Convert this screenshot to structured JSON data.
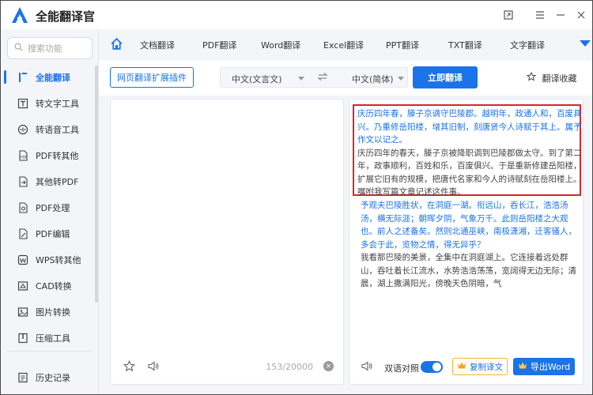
{
  "app": {
    "title": "全能翻译官"
  },
  "window": {
    "restore_icon": "restore-icon",
    "menu_icon": "menu-icon",
    "minimize_icon": "minimize-icon",
    "close_icon": "close-icon"
  },
  "sidebar": {
    "search_placeholder": "搜索功能",
    "items": [
      {
        "label": "全能翻译",
        "icon": "translate-icon",
        "active": true
      },
      {
        "label": "转文字工具",
        "icon": "text-convert-icon"
      },
      {
        "label": "转语音工具",
        "icon": "speech-icon"
      },
      {
        "label": "PDF转其他",
        "icon": "pdf-export-icon"
      },
      {
        "label": "其他转PDF",
        "icon": "pdf-import-icon"
      },
      {
        "label": "PDF处理",
        "icon": "pdf-process-icon"
      },
      {
        "label": "PDF编辑",
        "icon": "pdf-edit-icon"
      },
      {
        "label": "WPS转其他",
        "icon": "wps-icon"
      },
      {
        "label": "CAD转换",
        "icon": "cad-icon"
      },
      {
        "label": "图片转换",
        "icon": "image-icon"
      },
      {
        "label": "压缩工具",
        "icon": "compress-icon"
      }
    ],
    "history": "历史记录"
  },
  "tabs": {
    "items": [
      "文档翻译",
      "PDF翻译",
      "Word翻译",
      "Excel翻译",
      "PPT翻译",
      "TXT翻译",
      "文字翻译"
    ],
    "active": "文字翻译"
  },
  "toolbar": {
    "extension_button": "网页翻译扩展插件",
    "source_lang": "中文(文言文)",
    "target_lang": "中文(简体)",
    "translate_button": "立即翻译",
    "favorites": "翻译收藏"
  },
  "input_panel": {
    "count": "153/20000"
  },
  "output_panel": {
    "highlighted_source": "庆历四年春，滕子京谪守巴陵郡。越明年，政通人和，百废具兴。乃重修岳阳楼，增其旧制，刻唐贤今人诗赋于其上。属予作文以记之。",
    "highlighted_target": "庆历四年的春天，滕子京被降职调到巴陵郡做太守。到了第二年，政事顺利，百姓和乐，百废俱兴。于是重新修建岳阳楼，扩展它旧有的规模，把唐代名家和今人的诗赋刻在岳阳楼上。嘱咐我写篇文章记述这件事。",
    "source_2": "予观夫巴陵胜状，在洞庭一湖。衔远山，吞长江，浩浩汤汤，横无际涯；朝晖夕阴，气象万千。此则岳阳楼之大观也。前人之述备矣。然则北通巫峡，南极潇湘，迁客骚人，多会于此，览物之情，得无异乎？",
    "target_2": "我看那巴陵的美景，全集中在洞庭湖上。它连接着远处群山，吞吐着长江流水，水势浩浩荡荡，宽阔得无边无际；清晨，湖上撒满阳光，傍晚天色阴暗，气"
  },
  "footer": {
    "bilingual_label": "双语对照",
    "bilingual_on": true,
    "copy_button": "复制译文",
    "export_button": "导出Word"
  },
  "colors": {
    "accent": "#1a73e8",
    "highlight_border": "#d6262a"
  }
}
